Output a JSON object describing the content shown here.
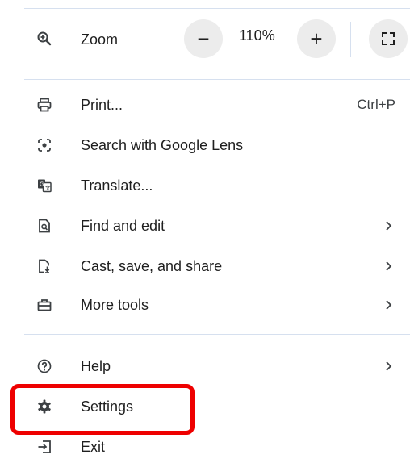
{
  "zoom": {
    "label": "Zoom",
    "decrease_label": "−",
    "value": "110%",
    "increase_label": "+",
    "icon": "zoom-in-icon",
    "fullscreen_icon": "fullscreen-icon"
  },
  "menu": {
    "print": {
      "label": "Print...",
      "shortcut": "Ctrl+P",
      "icon": "print-icon"
    },
    "lens": {
      "label": "Search with Google Lens",
      "icon": "google-lens-icon"
    },
    "translate": {
      "label": "Translate...",
      "icon": "translate-icon"
    },
    "find": {
      "label": "Find and edit",
      "icon": "find-page-icon"
    },
    "cast": {
      "label": "Cast, save, and share",
      "icon": "cast-save-icon"
    },
    "more_tools": {
      "label": "More tools",
      "icon": "toolbox-icon"
    },
    "help": {
      "label": "Help",
      "icon": "help-icon"
    },
    "settings": {
      "label": "Settings",
      "icon": "gear-icon"
    },
    "exit": {
      "label": "Exit",
      "icon": "exit-icon"
    }
  },
  "colors": {
    "highlight": "#ee0000",
    "divider": "#d6e0ef",
    "button_bg": "#ececec"
  }
}
